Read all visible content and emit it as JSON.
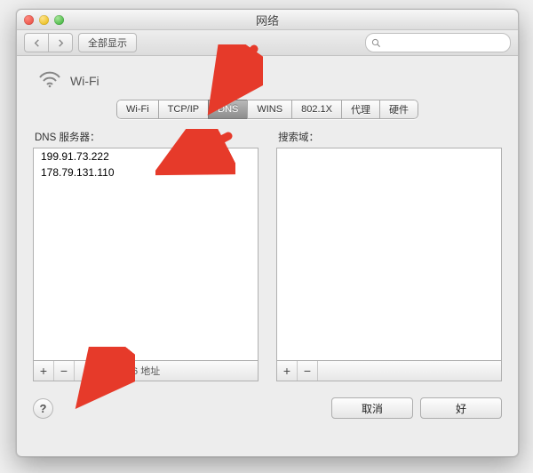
{
  "window": {
    "title": "网络"
  },
  "toolbar": {
    "show_all": "全部显示"
  },
  "header": {
    "interface": "Wi-Fi"
  },
  "tabs": [
    {
      "id": "wifi",
      "label": "Wi-Fi",
      "selected": false
    },
    {
      "id": "tcpip",
      "label": "TCP/IP",
      "selected": false
    },
    {
      "id": "dns",
      "label": "DNS",
      "selected": true
    },
    {
      "id": "wins",
      "label": "WINS",
      "selected": false
    },
    {
      "id": "8021x",
      "label": "802.1X",
      "selected": false
    },
    {
      "id": "proxy",
      "label": "代理",
      "selected": false
    },
    {
      "id": "hw",
      "label": "硬件",
      "selected": false
    }
  ],
  "dns": {
    "servers_label": "DNS 服务器：",
    "servers": [
      "199.91.73.222",
      "178.79.131.110"
    ],
    "add_remove_hint": "IPv4 或 IPv6 地址",
    "search_label": "搜索域："
  },
  "buttons": {
    "add": "+",
    "remove": "−",
    "help": "?",
    "cancel": "取消",
    "ok": "好"
  },
  "colors": {
    "arrow": "#e63a2a"
  }
}
